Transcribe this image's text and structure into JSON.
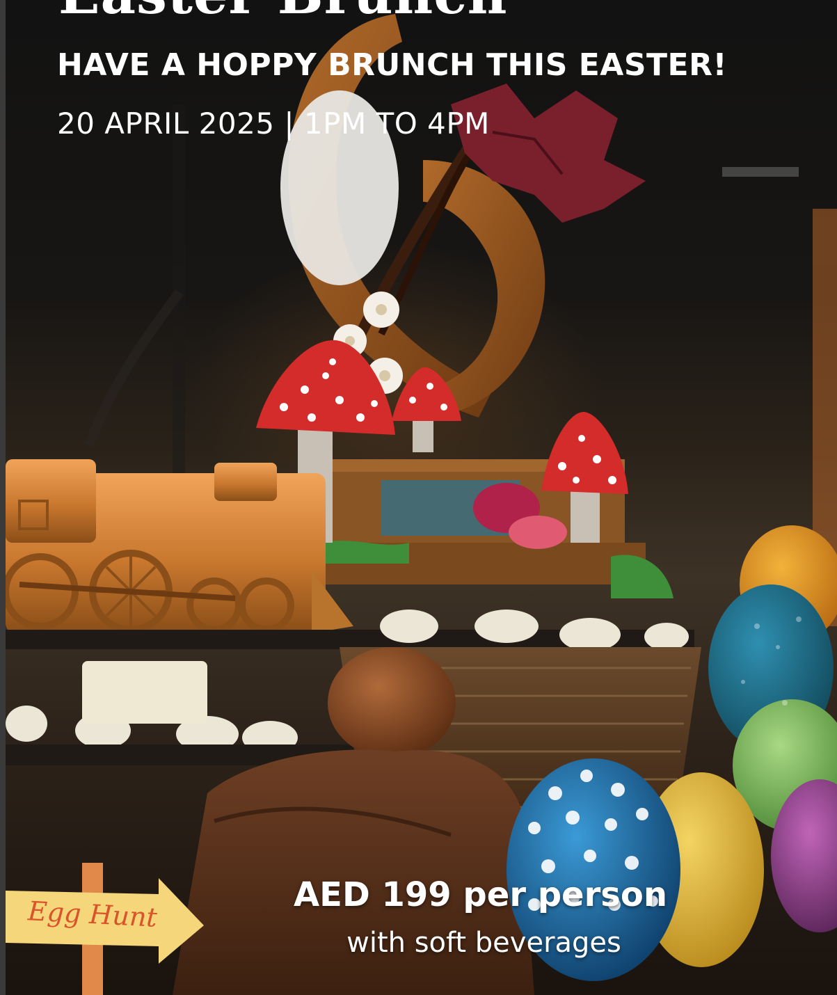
{
  "poster": {
    "headline": "Easter Brunch",
    "subtitle": "HAVE A HOPPY BRUNCH THIS EASTER!",
    "date_line": "20 APRIL 2025 | 1PM TO 4PM",
    "price": "AED 199 per person",
    "price_note": "with soft beverages",
    "sign_label": "Egg Hunt"
  },
  "colors": {
    "text": "#ffffff",
    "background": "#141414",
    "chocolate": "#8a5524",
    "mushroom_cap": "#d42b2b",
    "egg_blue": "#1f6fa8",
    "egg_yellow": "#e8c03a",
    "egg_green": "#7cba5a",
    "egg_purple": "#8c3c8c",
    "sign": "#f6d67a"
  }
}
